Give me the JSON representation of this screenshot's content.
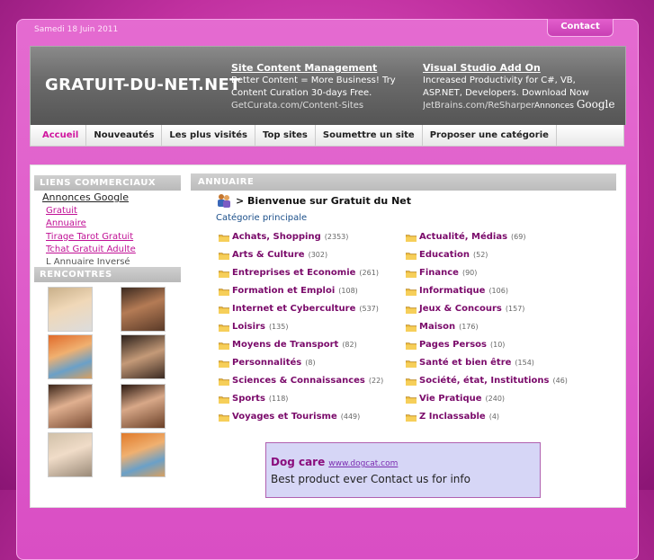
{
  "date": "Samedi 18 Juin 2011",
  "contact_label": "Contact",
  "logo": "GRATUIT-DU-NET.NET",
  "header_ads": [
    {
      "title": "Site Content Management",
      "desc": "Better Content = More Business! Try Content Curation 30-days Free.",
      "url": "GetCurata.com/Content-Sites"
    },
    {
      "title": "Visual Studio Add On",
      "desc": "Increased Productivity for C#, VB, ASP.NET, Developers. Download Now",
      "url": "JetBrains.com/ReSharper"
    }
  ],
  "annonces_label": "Annonces",
  "google_label": "Google",
  "nav": [
    "Accueil",
    "Nouveautés",
    "Les plus visités",
    "Top sites",
    "Soumettre un site",
    "Proposer une catégorie"
  ],
  "sidebar": {
    "liens_title": "LIENS COMMERCIAUX",
    "annonces_google": "Annonces Google",
    "links": [
      "Gratuit",
      "Annuaire",
      "Tirage Tarot Gratuit",
      "Tchat Gratuit Adulte",
      "L Annuaire Inversé"
    ],
    "rencontres_title": "RENCONTRES"
  },
  "content": {
    "title": "ANNUAIRE",
    "welcome": "> Bienvenue sur Gratuit du Net",
    "categorie_principale": "Catégorie principale",
    "left": [
      {
        "name": "Achats, Shopping",
        "count": "(2353)"
      },
      {
        "name": "Arts & Culture",
        "count": "(302)"
      },
      {
        "name": "Entreprises et Economie",
        "count": "(261)"
      },
      {
        "name": "Formation et Emploi",
        "count": "(108)"
      },
      {
        "name": "Internet et Cyberculture",
        "count": "(537)"
      },
      {
        "name": "Loisirs",
        "count": "(135)"
      },
      {
        "name": "Moyens de Transport",
        "count": "(82)"
      },
      {
        "name": "Personnalités",
        "count": "(8)"
      },
      {
        "name": "Sciences & Connaissances",
        "count": "(22)"
      },
      {
        "name": "Sports",
        "count": "(118)"
      },
      {
        "name": "Voyages et Tourisme",
        "count": "(449)"
      }
    ],
    "right": [
      {
        "name": "Actualité, Médias",
        "count": "(69)"
      },
      {
        "name": "Education",
        "count": "(52)"
      },
      {
        "name": "Finance",
        "count": "(90)"
      },
      {
        "name": "Informatique",
        "count": "(106)"
      },
      {
        "name": "Jeux & Concours",
        "count": "(157)"
      },
      {
        "name": "Maison",
        "count": "(176)"
      },
      {
        "name": "Pages Persos",
        "count": "(10)"
      },
      {
        "name": "Santé et bien être",
        "count": "(154)"
      },
      {
        "name": "Société, état, Institutions",
        "count": "(46)"
      },
      {
        "name": "Vie Pratique",
        "count": "(240)"
      },
      {
        "name": "Z Inclassable",
        "count": "(4)"
      }
    ]
  },
  "bottom_ad": {
    "title": "Dog care",
    "url": "www.dogcat.com",
    "desc": "Best product ever Contact us for info"
  },
  "colors": {
    "accent": "#d0169f",
    "category": "#7a0a6a",
    "link": "#c01095"
  }
}
